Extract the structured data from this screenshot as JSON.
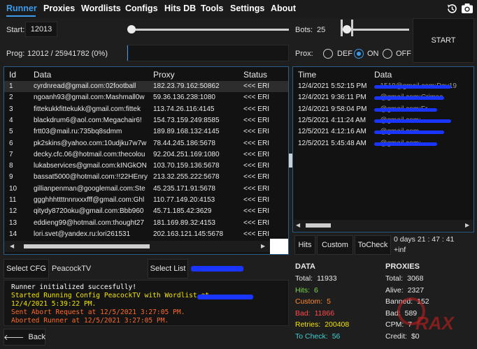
{
  "menu": {
    "items": [
      "Runner",
      "Proxies",
      "Wordlists",
      "Configs",
      "Hits DB",
      "Tools",
      "Settings",
      "About"
    ],
    "icons": [
      "history-icon",
      "camera-icon"
    ]
  },
  "controls": {
    "start_label": "Start:",
    "start_value": "12013",
    "bots_label": "Bots:",
    "bots_value": "25",
    "start_button": "START",
    "prog_label": "Prog:",
    "prog_value": "12012 / 25941782 (0%)",
    "prog_fraction": 0.0005,
    "proxy_label": "Prox:",
    "proxy_options": [
      "DEF",
      "ON",
      "OFF"
    ],
    "proxy_selected": "ON"
  },
  "data_table": {
    "columns": [
      "Id",
      "Data",
      "Proxy",
      "Status"
    ],
    "rows": [
      [
        "1",
        "cyrdnread@gmail.com:02football",
        "182.23.79.162:50862",
        "<<< ERI"
      ],
      [
        "2",
        "ngoanh93@gmail.com:Mashmall0w",
        "59.36.136.238:1080",
        "<<< ERI"
      ],
      [
        "3",
        "fittekukkfittekukk@gmail.com:fittek",
        "113.74.26.116:4145",
        "<<< ERI"
      ],
      [
        "4",
        "blackdrum6@aol.com:Megachair6!",
        "154.73.159.249:8585",
        "<<< ERI"
      ],
      [
        "5",
        "frtt03@mail.ru:735bq8sdmm",
        "189.89.168.132:4145",
        "<<< ERI"
      ],
      [
        "6",
        "pk2skins@yahoo.com:10udjku7w7w",
        "78.44.245.186:5678",
        "<<< ERI"
      ],
      [
        "7",
        "decky.cfc.06@hotmail.com:thecolou",
        "92.204.251.169:1080",
        "<<< ERI"
      ],
      [
        "8",
        "lukabservices@gmail.com:kINGkON",
        "103.70.159.136:5678",
        "<<< ERI"
      ],
      [
        "9",
        "bassat5000@hotmail.com:!!22HEnry",
        "213.32.255.222:5678",
        "<<< ERI"
      ],
      [
        "10",
        "gillianpenman@googlemail.com:Ste",
        "45.235.171.91:5678",
        "<<< ERI"
      ],
      [
        "11",
        "ggghhhttttnnnxxxfff@gmail.com:Ghl",
        "110.77.149.20:4153",
        "<<< ERI"
      ],
      [
        "12",
        "qitydy8720oku@gmail.com:Bbb960",
        "45.71.185.42:3629",
        "<<< ERI"
      ],
      [
        "13",
        "eddieng99@hotmail.com:thought27",
        "181.169.89.32:4153",
        "<<< ERI"
      ],
      [
        "14",
        "lori.svet@yandex.ru:lori261531",
        "202.163.121.145:5678",
        "<<< ERI"
      ]
    ]
  },
  "hits_table": {
    "columns": [
      "Time",
      "Data"
    ],
    "rows": [
      [
        "12/4/2021 5:52:15 PM",
        "...1518@gmail.com:Dav19"
      ],
      [
        "12/4/2021 9:36:11 PM",
        "...@gmail.com:Crimso"
      ],
      [
        "12/4/2021 9:58:04 PM",
        "...@gmail.com:Fr..."
      ],
      [
        "12/5/2021 4:11:24 AM",
        "...@gmail.com:..."
      ],
      [
        "12/5/2021 4:12:16 AM",
        "...@gmail.com..."
      ],
      [
        "12/5/2021 5:45:48 AM",
        "...@gmail.com:..."
      ]
    ]
  },
  "hits_tabs": [
    "Hits",
    "Custom",
    "ToCheck"
  ],
  "timer": {
    "elapsed": "0 days 21 : 47 : 41",
    "rate": "+inf"
  },
  "cfg": {
    "select_cfg_label": "Select CFG",
    "cfg_name": "PeacockTV",
    "select_list_label": "Select List"
  },
  "log": [
    {
      "text": "Runner initialized succesfully!",
      "color": "#ffffff"
    },
    {
      "text": "Started Running Config PeacockTV with Wordlist                    at",
      "color": "#f2e600"
    },
    {
      "text": "12/4/2021 5:39:22 PM.",
      "color": "#f2e600"
    },
    {
      "text": "Sent Abort Request at 12/5/2021 3:27:05 PM.",
      "color": "#ff6a2a"
    },
    {
      "text": "Aborted Runner at 12/5/2021 3:27:05 PM.",
      "color": "#ff6a2a"
    }
  ],
  "back_button": "Back",
  "data_stats": {
    "title": "DATA",
    "items": [
      {
        "k": "Total:",
        "v": "11933",
        "color": "#e8e8e8"
      },
      {
        "k": "Hits:",
        "v": "6",
        "color": "#7bd94a"
      },
      {
        "k": "Custom:",
        "v": "5",
        "color": "#ff8a2a"
      },
      {
        "k": "Bad:",
        "v": "11866",
        "color": "#ff4a4a"
      },
      {
        "k": "Retries:",
        "v": "200408",
        "color": "#f2e600"
      },
      {
        "k": "To Check:",
        "v": "56",
        "color": "#3fd0d0"
      }
    ]
  },
  "proxy_stats": {
    "title": "PROXIES",
    "items": [
      {
        "k": "Total:",
        "v": "3068"
      },
      {
        "k": "Alive:",
        "v": "2327"
      },
      {
        "k": "Banned:",
        "v": "152"
      },
      {
        "k": "Bad:",
        "v": "589"
      },
      {
        "k": "CPM:",
        "v": "7"
      },
      {
        "k": "Credit:",
        "v": "$0"
      }
    ]
  },
  "colors": {
    "accent": "#3d9be9",
    "background": "#1e1e1e",
    "panel": "#141414"
  }
}
